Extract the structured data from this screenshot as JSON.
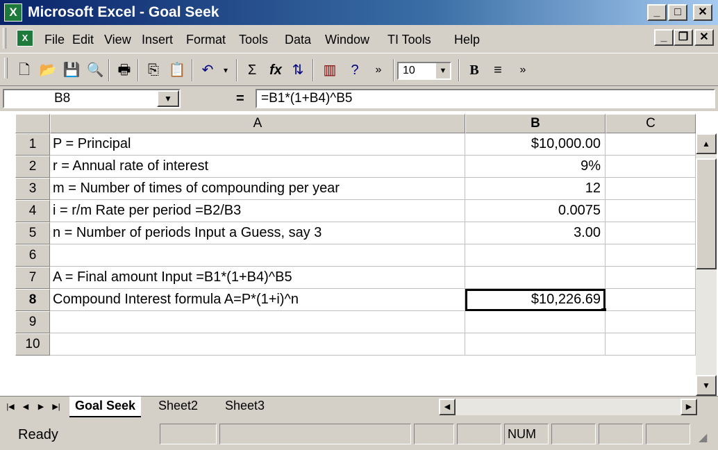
{
  "window": {
    "title": "Microsoft Excel - Goal Seek",
    "app_icon": "excel-icon",
    "caption_buttons": [
      "minimize",
      "maximize",
      "close"
    ]
  },
  "menu": {
    "items": [
      "File",
      "Edit",
      "View",
      "Insert",
      "Format",
      "Tools",
      "Data",
      "Window",
      "TI Tools",
      "Help"
    ]
  },
  "toolbar": {
    "buttons": [
      "new-icon",
      "open-icon",
      "save-icon",
      "print-preview-icon",
      "print-icon",
      "copy-icon",
      "paste-icon",
      "undo-icon",
      "autosum-icon",
      "function-icon",
      "sort-ascending-icon",
      "chart-wizard-icon",
      "help-icon"
    ],
    "font_size": "10",
    "bold_label": "B"
  },
  "formula_bar": {
    "name_box": "B8",
    "equals": "=",
    "formula": "=B1*(1+B4)^B5"
  },
  "grid": {
    "columns": [
      "A",
      "B",
      "C"
    ],
    "selected_column": "B",
    "selected_row": "8",
    "rows": [
      {
        "row": "1",
        "a": "P = Principal",
        "b": "$10,000.00"
      },
      {
        "row": "2",
        "a": "r = Annual rate of interest",
        "b": "9%"
      },
      {
        "row": "3",
        "a": "m = Number of times of compounding per year",
        "b": "12"
      },
      {
        "row": "4",
        "a": "i = r/m  Rate per period     =B2/B3",
        "b": "0.0075"
      },
      {
        "row": "5",
        "a": "n =  Number of periods    Input a Guess, say 3",
        "b": "3.00"
      },
      {
        "row": "6",
        "a": "",
        "b": ""
      },
      {
        "row": "7",
        "a": "A = Final amount   Input =B1*(1+B4)^B5",
        "b": ""
      },
      {
        "row": "8",
        "a": "Compound Interest formula   A=P*(1+i)^n",
        "b": "$10,226.69"
      },
      {
        "row": "9",
        "a": "",
        "b": ""
      },
      {
        "row": "10",
        "a": "",
        "b": ""
      }
    ]
  },
  "sheets": {
    "tabs": [
      "Goal Seek",
      "Sheet2",
      "Sheet3"
    ],
    "active": "Goal Seek"
  },
  "status": {
    "text": "Ready",
    "num": "NUM"
  }
}
